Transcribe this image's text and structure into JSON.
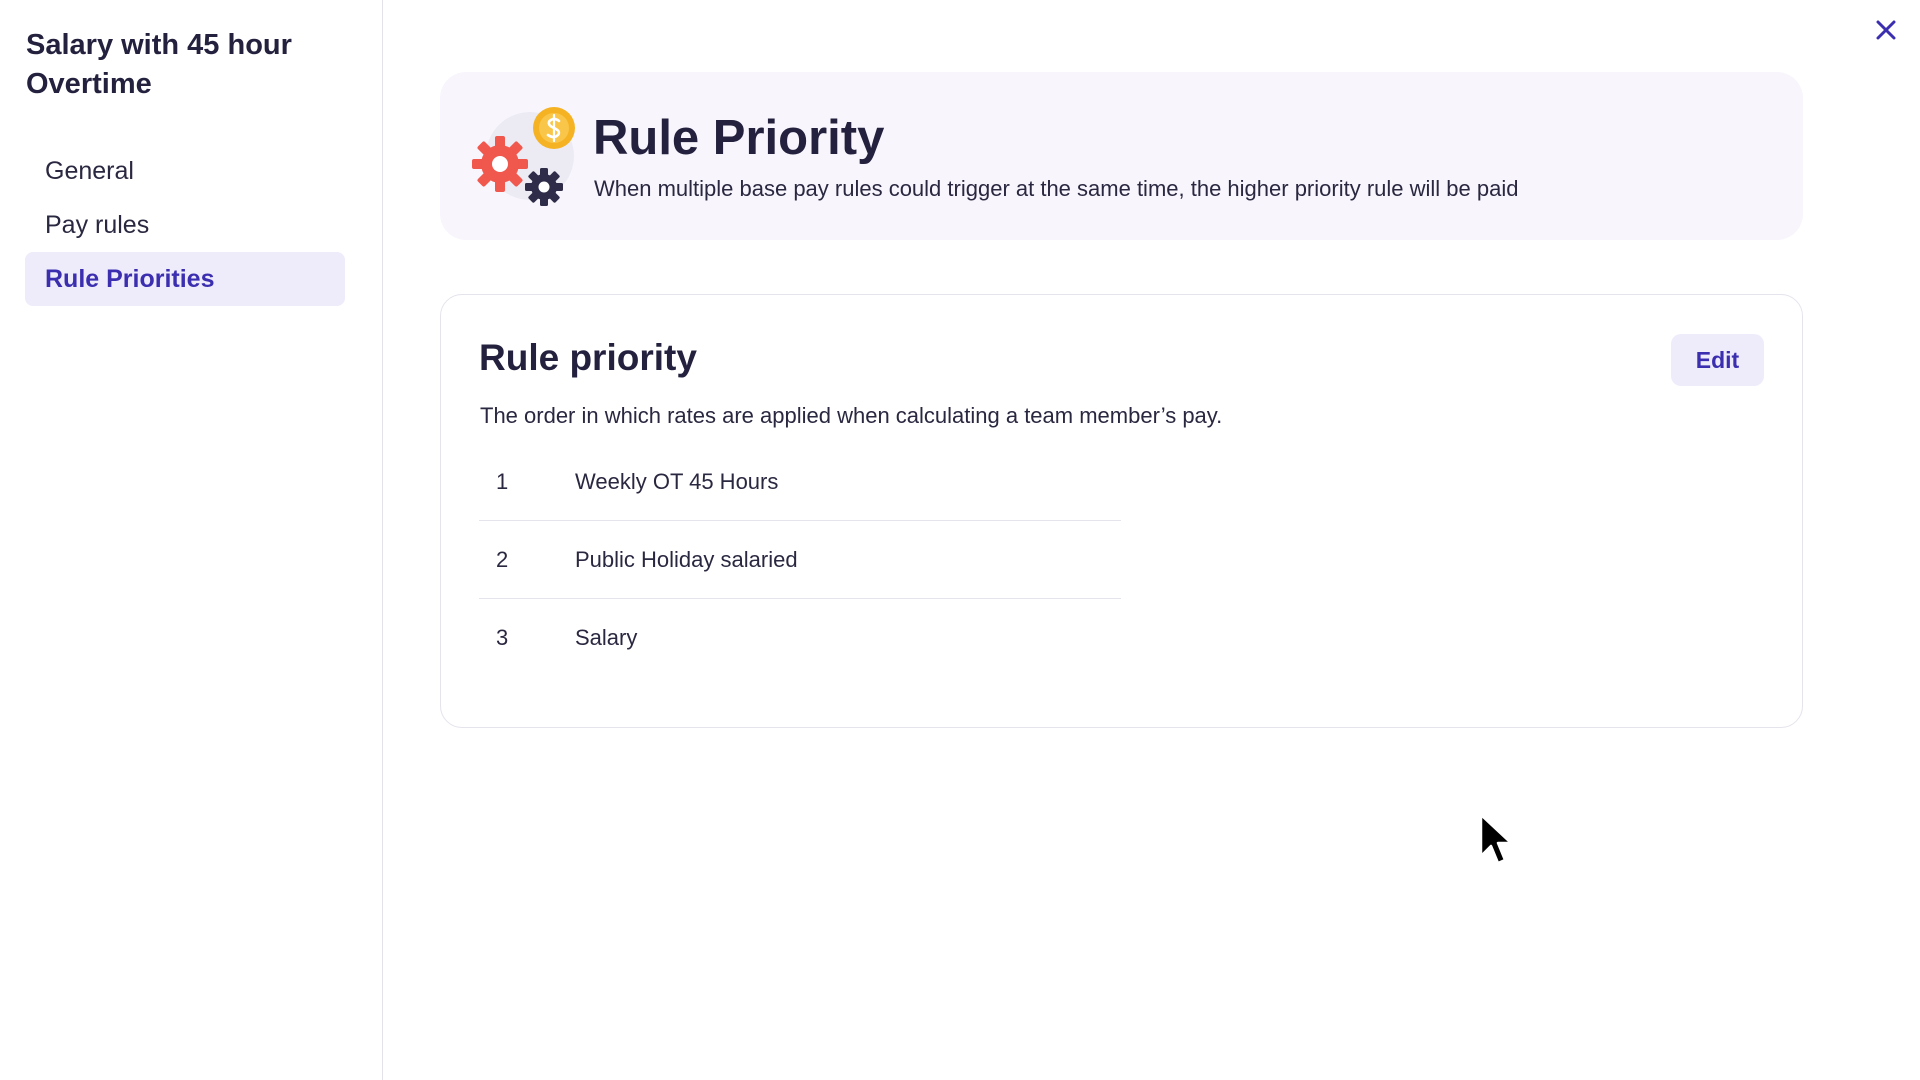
{
  "sidebar": {
    "title": "Salary with 45 hour Overtime",
    "items": [
      {
        "label": "General",
        "active": false
      },
      {
        "label": "Pay rules",
        "active": false
      },
      {
        "label": "Rule Priorities",
        "active": true
      }
    ]
  },
  "close": {
    "icon": "close-icon"
  },
  "banner": {
    "icon": "gears-coin-illustration",
    "title": "Rule Priority",
    "description": "When multiple base pay rules could trigger at the same time, the higher priority rule will be paid"
  },
  "card": {
    "title": "Rule priority",
    "edit_label": "Edit",
    "description": "The order in which rates are applied when calculating a team member’s pay.",
    "rules": [
      {
        "rank": "1",
        "name": "Weekly OT 45 Hours"
      },
      {
        "rank": "2",
        "name": "Public Holiday salaried"
      },
      {
        "rank": "3",
        "name": "Salary"
      }
    ]
  },
  "colors": {
    "accent": "#3b2fb0",
    "active_bg": "#eeecfb",
    "banner_bg": "#f8f5fd",
    "gear_red": "#f0574d",
    "gear_dark": "#2e2c48",
    "coin_yellow": "#f5b324"
  }
}
